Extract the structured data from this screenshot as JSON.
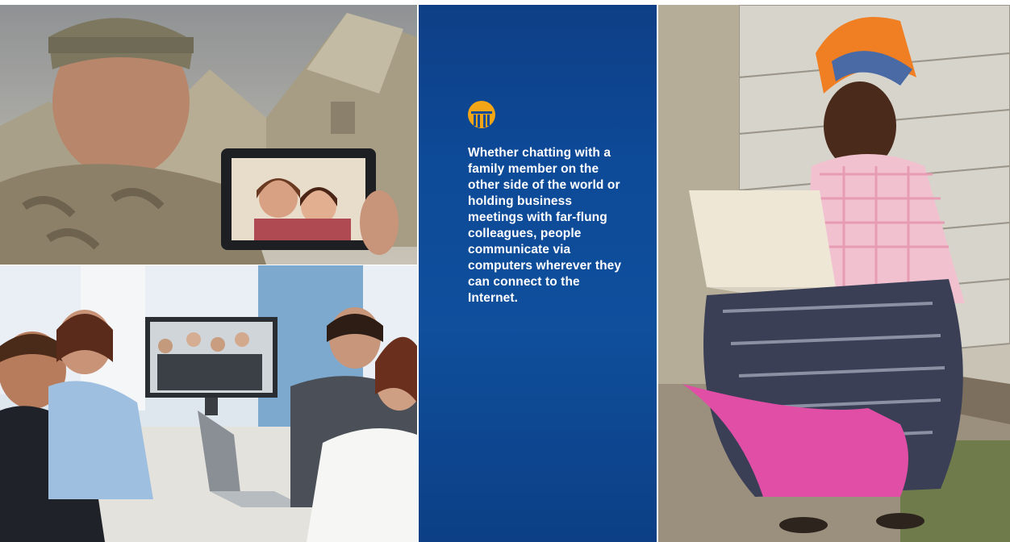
{
  "photos": {
    "soldier": {
      "alt": "Soldier video-chatting with family on a tablet"
    },
    "meeting": {
      "alt": "Business meeting with video conference"
    },
    "woman": {
      "alt": "Woman using a laptop outdoors"
    }
  },
  "caption": {
    "icon": "columns-building-icon",
    "icon_color": "#f2a516",
    "text": "Whether chatting with a family member on the other side of the world or holding business meetings with far-flung colleagues, people communicate via computers wherever they can connect to the Internet."
  },
  "colors": {
    "panel_blue": "#0d4a98",
    "text": "#ffffff"
  }
}
